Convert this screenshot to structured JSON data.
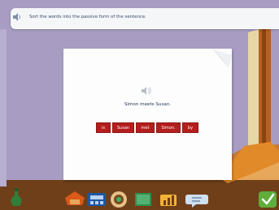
{
  "instruction": {
    "text": "Sort the words into the passive form of the sentence."
  },
  "exercise": {
    "sentence": "Simon meets Susan.",
    "word_tiles": [
      "is",
      "Susan",
      "met",
      "Simon.",
      "by"
    ]
  },
  "toolbar": {
    "icons": [
      "potion-icon",
      "home-icon",
      "calculator-icon",
      "dial-icon",
      "book-icon",
      "volume-icon",
      "chat-icon",
      "check-icon"
    ]
  },
  "colors": {
    "background": "#a89cc2",
    "tile": "#b51e1e",
    "check_button": "#5fae3c"
  }
}
